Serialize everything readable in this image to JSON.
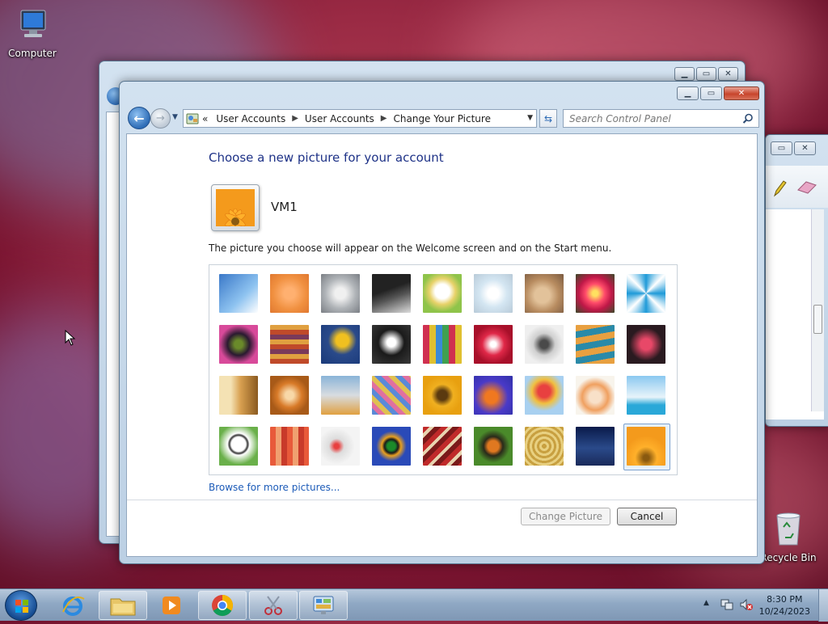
{
  "desktop": {
    "icons": [
      {
        "label": "Computer",
        "icon": "computer-icon"
      },
      {
        "label": "Recycle Bin",
        "icon": "recycle-bin-icon"
      }
    ]
  },
  "window": {
    "caption_buttons": {
      "minimize": "minimize-icon",
      "maximize": "maximize-icon",
      "close": "close-icon"
    },
    "nav": {
      "back": "back-arrow-icon",
      "forward": "forward-arrow-icon"
    },
    "address_bar": {
      "root_chevron": "«",
      "crumbs": [
        "User Accounts",
        "User Accounts",
        "Change Your Picture"
      ]
    },
    "search": {
      "placeholder": "Search Control Panel"
    },
    "heading": "Choose a new picture for your account",
    "account_name": "VM1",
    "description": "The picture you choose will appear on the Welcome screen and on the Start menu.",
    "pictures": [
      "roller-coaster",
      "starfish",
      "robot-toy",
      "turntable",
      "lucky-cat",
      "gyroscope",
      "kitten",
      "pink-flower",
      "pinwheel",
      "ball",
      "fabric",
      "ginkgo-leaf",
      "dog",
      "crayons",
      "paper-star",
      "jacks",
      "stairs",
      "origami-crane",
      "guitar",
      "puppy",
      "tin-robot",
      "scarf",
      "sunflower",
      "fish",
      "balloon",
      "doll",
      "sailboat",
      "soccer-ball",
      "textile",
      "marbles",
      "window",
      "carpet",
      "butterfly",
      "basket",
      "lighthouse",
      "orange-flower"
    ],
    "selected_picture": "orange-flower",
    "browse_link": "Browse for more pictures...",
    "buttons": {
      "change": "Change Picture",
      "cancel": "Cancel"
    }
  },
  "taskbar": {
    "items": [
      "start-orb-icon",
      "internet-explorer-icon",
      "file-explorer-icon",
      "media-player-icon",
      "chrome-icon",
      "snipping-tool-icon",
      "control-panel-icon"
    ],
    "clock": {
      "time": "8:30 PM",
      "date": "10/24/2023"
    }
  }
}
